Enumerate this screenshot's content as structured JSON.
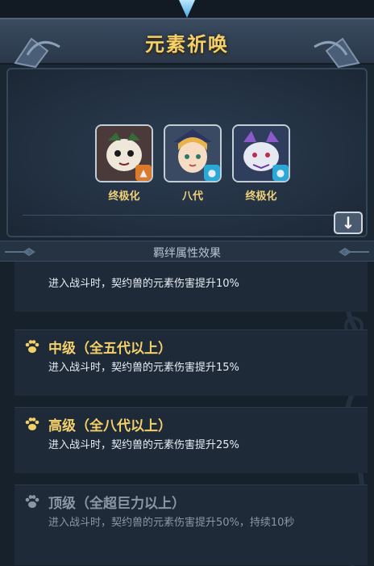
{
  "title": "元素祈唤",
  "characters": [
    {
      "tag": "终极化",
      "element_icon": "fire-element-icon",
      "element_color": "#d97b2a"
    },
    {
      "tag": "八代",
      "element_icon": "water-element-icon",
      "element_color": "#2aa9d9"
    },
    {
      "tag": "终极化",
      "element_icon": "water-element-icon",
      "element_color": "#2aa9d9"
    }
  ],
  "section_title": "羁绊属性效果",
  "bonds": [
    {
      "name": "",
      "desc": "进入战斗时，契约兽的元素伤害提升10%",
      "active": true
    },
    {
      "name": "中级（全五代以上）",
      "desc": "进入战斗时，契约兽的元素伤害提升15%",
      "active": true
    },
    {
      "name": "高级（全八代以上）",
      "desc": "进入战斗时，契约兽的元素伤害提升25%",
      "active": true
    },
    {
      "name": "顶级（全超巨力以上）",
      "desc": "进入战斗时，契约兽的元素伤害提升50%，持续10秒",
      "active": false
    }
  ],
  "colors": {
    "gold": "#f3d06a",
    "locked": "#8c97a3"
  }
}
